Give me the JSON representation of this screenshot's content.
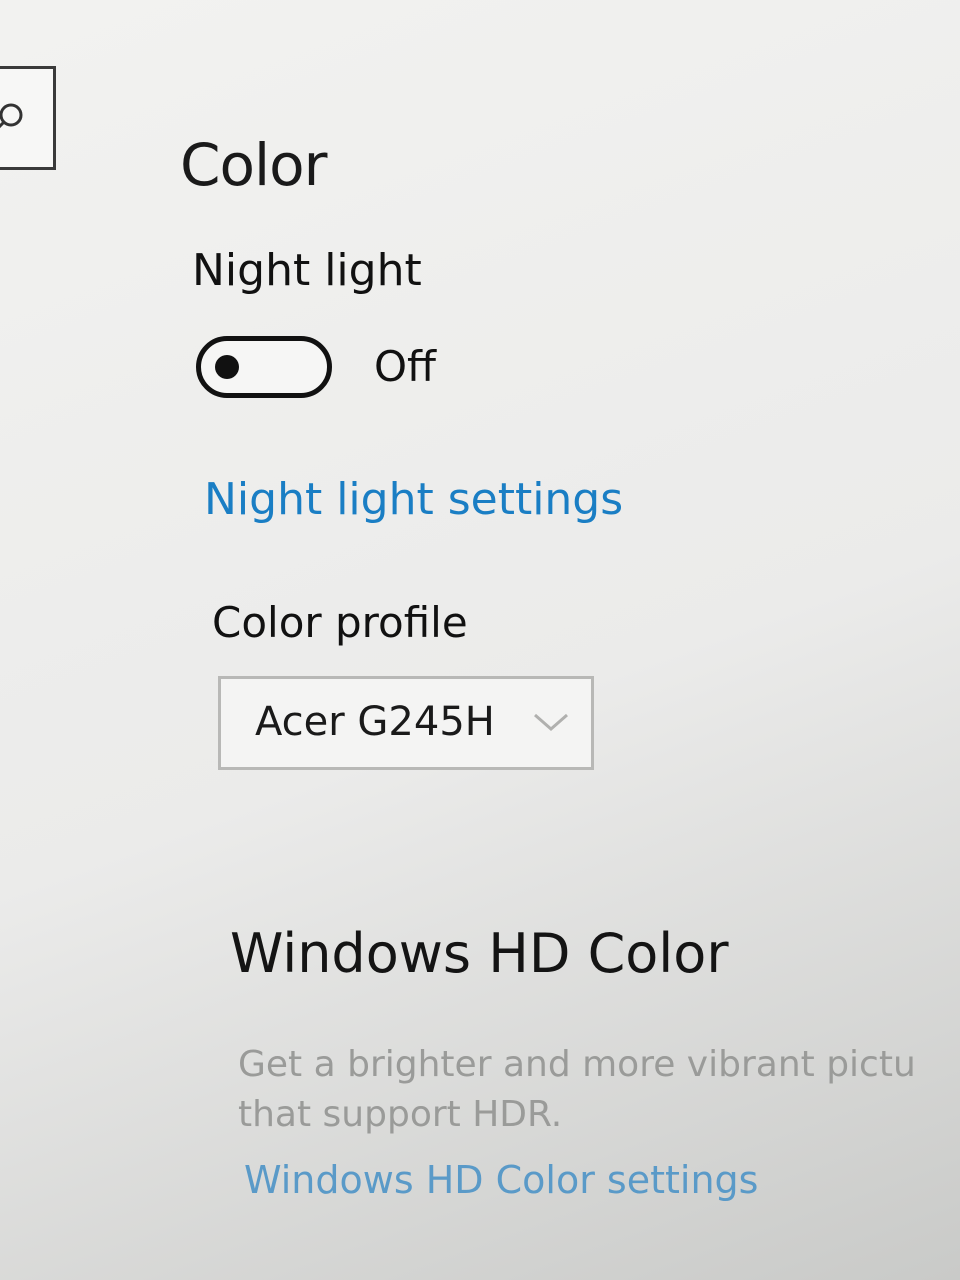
{
  "search": {
    "icon": "search-icon"
  },
  "page": {
    "title": "Color"
  },
  "night_light": {
    "label": "Night light",
    "toggle_state": "Off",
    "settings_link": "Night light settings"
  },
  "color_profile": {
    "label": "Color profile",
    "selected": "Acer G245H",
    "dropdown_icon": "chevron-down-icon"
  },
  "hd_color": {
    "title": "Windows HD Color",
    "description_line1": "Get a brighter and more vibrant pictu",
    "description_line2": "that support HDR.",
    "settings_link": "Windows HD Color settings"
  },
  "colors": {
    "link": "#1a7ec4",
    "text": "#1a1a1a",
    "muted": "#9a9b99"
  }
}
